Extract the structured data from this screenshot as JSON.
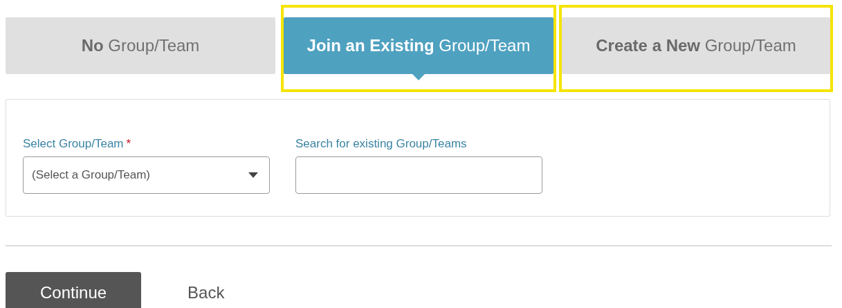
{
  "tabs": [
    {
      "label": "**No** Group/Team",
      "selected": false,
      "highlighted": false
    },
    {
      "label": "**Join an Existing** Group/Team",
      "selected": true,
      "highlighted": true
    },
    {
      "label": "**Create a New** Group/Team",
      "selected": false,
      "highlighted": true
    }
  ],
  "form": {
    "fields": [
      {
        "kind": "select",
        "label": "Select Group/Team",
        "required_mark": "*",
        "value": "(Select a Group/Team)"
      },
      {
        "kind": "text",
        "label": "Search for existing Group/Teams"
      }
    ]
  },
  "buttons": [
    {
      "label": "Continue",
      "kind": "primary"
    },
    {
      "label": "Back",
      "kind": "link"
    }
  ]
}
